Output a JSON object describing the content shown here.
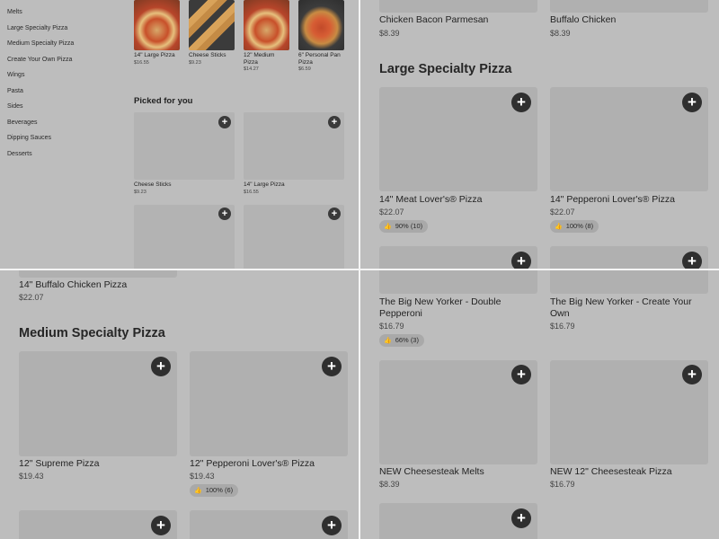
{
  "sidebar": {
    "items": [
      "Melts",
      "Large Specialty Pizza",
      "Medium Specialty Pizza",
      "Create Your Own Pizza",
      "Wings",
      "Pasta",
      "Sides",
      "Beverages",
      "Dipping Sauces",
      "Desserts"
    ]
  },
  "top_strip": [
    {
      "name": "14\" Large Pizza",
      "price": "$16.55",
      "image": "pizza"
    },
    {
      "name": "Cheese Sticks",
      "price": "$9.23",
      "image": "cheese-sticks"
    },
    {
      "name": "12\" Medium Pizza",
      "price": "$14.27",
      "image": "pizza"
    },
    {
      "name": "6\" Personal Pan Pizza",
      "price": "$6.59",
      "image": "pan-pizza"
    }
  ],
  "picked": {
    "title": "Picked for you",
    "items": [
      {
        "name": "Cheese Sticks",
        "price": "$9.23"
      },
      {
        "name": "14\" Large Pizza",
        "price": "$16.55"
      }
    ]
  },
  "tr": {
    "top_items": [
      {
        "name": "Chicken Bacon Parmesan",
        "price": "$8.39"
      },
      {
        "name": "Buffalo Chicken",
        "price": "$8.39"
      }
    ],
    "section_title": "Large Specialty Pizza",
    "cards": [
      {
        "name": "14\" Meat Lover's® Pizza",
        "price": "$22.07",
        "rating": "90% (10)"
      },
      {
        "name": "14\" Pepperoni Lover's® Pizza",
        "price": "$22.07",
        "rating": "100% (8)"
      }
    ]
  },
  "bl": {
    "top_item": {
      "name": "14\" Buffalo Chicken Pizza",
      "price": "$22.07"
    },
    "section_title": "Medium Specialty Pizza",
    "cards": [
      {
        "name": "12\" Supreme Pizza",
        "price": "$19.43"
      },
      {
        "name": "12\" Pepperoni Lover's® Pizza",
        "price": "$19.43",
        "rating": "100% (6)"
      }
    ]
  },
  "br": {
    "cards": [
      {
        "name": "The Big New Yorker - Double Pepperoni",
        "price": "$16.79",
        "rating": "66% (3)"
      },
      {
        "name": "The Big New Yorker - Create Your Own",
        "price": "$16.79"
      },
      {
        "name": "NEW Cheesesteak Melts",
        "price": "$8.39"
      },
      {
        "name": "NEW 12\" Cheesesteak Pizza",
        "price": "$16.79"
      }
    ]
  },
  "icons": {
    "add": "+",
    "thumbs_up": "👍"
  }
}
